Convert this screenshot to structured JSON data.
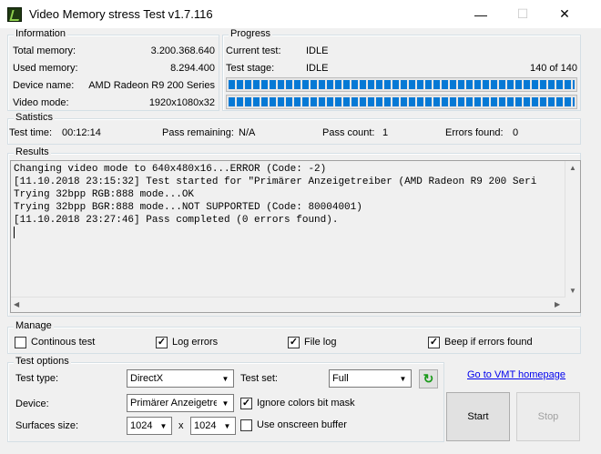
{
  "window": {
    "title": "Video Memory stress Test v1.7.116",
    "minimize": "—",
    "maximize": "☐",
    "close": "✕"
  },
  "information": {
    "legend": "Information",
    "rows": [
      {
        "label": "Total memory:",
        "value": "3.200.368.640"
      },
      {
        "label": "Used memory:",
        "value": "8.294.400"
      },
      {
        "label": "Device name:",
        "value": "AMD Radeon R9 200 Series"
      },
      {
        "label": "Video mode:",
        "value": "1920x1080x32"
      }
    ]
  },
  "progress": {
    "legend": "Progress",
    "current_test_label": "Current test:",
    "current_test_value": "IDLE",
    "test_stage_label": "Test stage:",
    "test_stage_value": "IDLE",
    "count_text": "140 of 140",
    "bar1_fraction": 1.0,
    "bar2_fraction": 1.0
  },
  "statistics": {
    "legend": "Satistics",
    "test_time_label": "Test time:",
    "test_time_value": "00:12:14",
    "pass_remaining_label": "Pass remaining:",
    "pass_remaining_value": "N/A",
    "pass_count_label": "Pass count:",
    "pass_count_value": "1",
    "errors_found_label": "Errors found:",
    "errors_found_value": "0"
  },
  "results": {
    "legend": "Results",
    "lines": [
      "Changing video mode to 640x480x16...ERROR (Code: -2)",
      "[11.10.2018 23:15:32] Test started for \"Primärer Anzeigetreiber (AMD Radeon R9 200 Seri",
      "Trying 32bpp RGB:888 mode...OK",
      "Trying 32bpp BGR:888 mode...NOT SUPPORTED (Code: 80004001)",
      "[11.10.2018 23:27:46] Pass completed (0 errors found)."
    ]
  },
  "manage": {
    "legend": "Manage",
    "continous_test": {
      "label": "Continous test",
      "checked": false,
      "mark": ""
    },
    "log_errors": {
      "label": "Log errors",
      "checked": true,
      "mark": "✓"
    },
    "file_log": {
      "label": "File log",
      "checked": true,
      "mark": "✓"
    },
    "beep": {
      "label": "Beep if errors found",
      "checked": true,
      "mark": "✓"
    }
  },
  "test_options": {
    "legend": "Test options",
    "test_type_label": "Test type:",
    "test_type_value": "DirectX",
    "test_set_label": "Test set:",
    "test_set_value": "Full",
    "device_label": "Device:",
    "device_value": "Primärer Anzeigetrei",
    "ignore_colors": {
      "label": "Ignore colors bit mask",
      "checked": true,
      "mark": "✓"
    },
    "surfaces_label": "Surfaces size:",
    "surface_w": "1024",
    "surface_x": "x",
    "surface_h": "1024",
    "onscreen": {
      "label": "Use onscreen buffer",
      "checked": false,
      "mark": ""
    },
    "refresh_icon": "↻"
  },
  "link": "Go to VMT homepage",
  "buttons": {
    "start": "Start",
    "stop": "Stop"
  },
  "colors": {
    "progress_blue": "#0679d5",
    "link": "#0000ee"
  }
}
